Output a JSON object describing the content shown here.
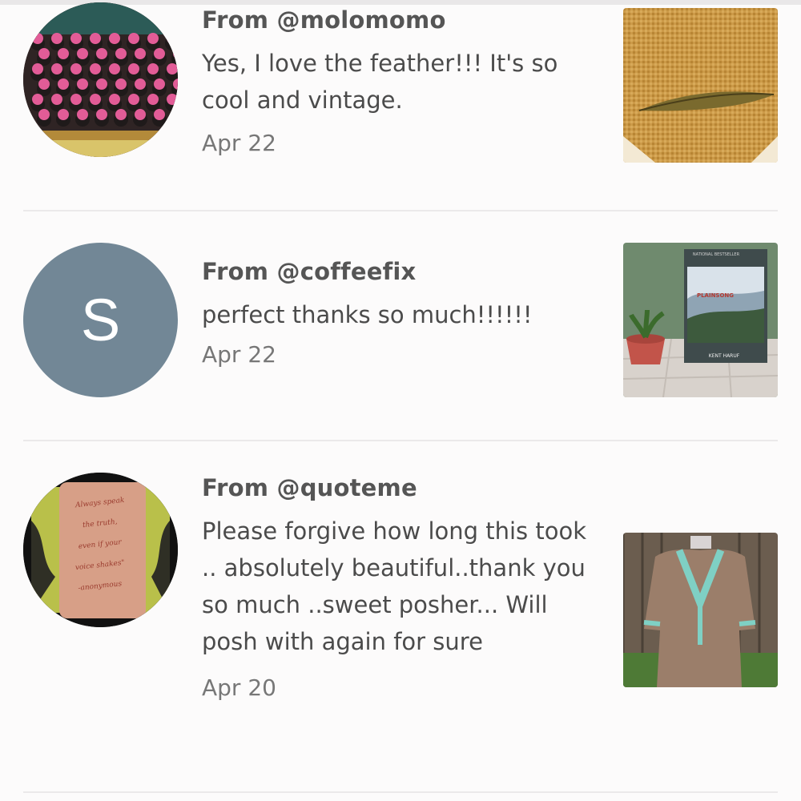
{
  "feedback": [
    {
      "from": "From @molomomo",
      "message": "Yes, I love the feather!!! It's so cool and vintage.",
      "date": "Apr 22",
      "avatar_initial": "",
      "avatar_color": "#2b2b2b"
    },
    {
      "from": "From @coffeefix",
      "message": "perfect thanks so much!!!!!!",
      "date": "Apr 22",
      "avatar_initial": "S",
      "avatar_color": "#728796"
    },
    {
      "from": "From @quoteme",
      "message": "Please forgive how long this took .. absolutely beautiful..thank you so much ..sweet posher... Will posh with again for sure",
      "date": "Apr 20",
      "avatar_initial": "",
      "avatar_color": "#1a1a1a"
    }
  ],
  "book_thumb": {
    "badge": "NATIONAL BESTSELLER",
    "title": "PLAINSONG",
    "author": "KENT HARUF"
  },
  "tattoo_text": [
    "Always speak",
    "the truth,",
    "even if your",
    "voice shakes\"",
    "-anonymous"
  ]
}
